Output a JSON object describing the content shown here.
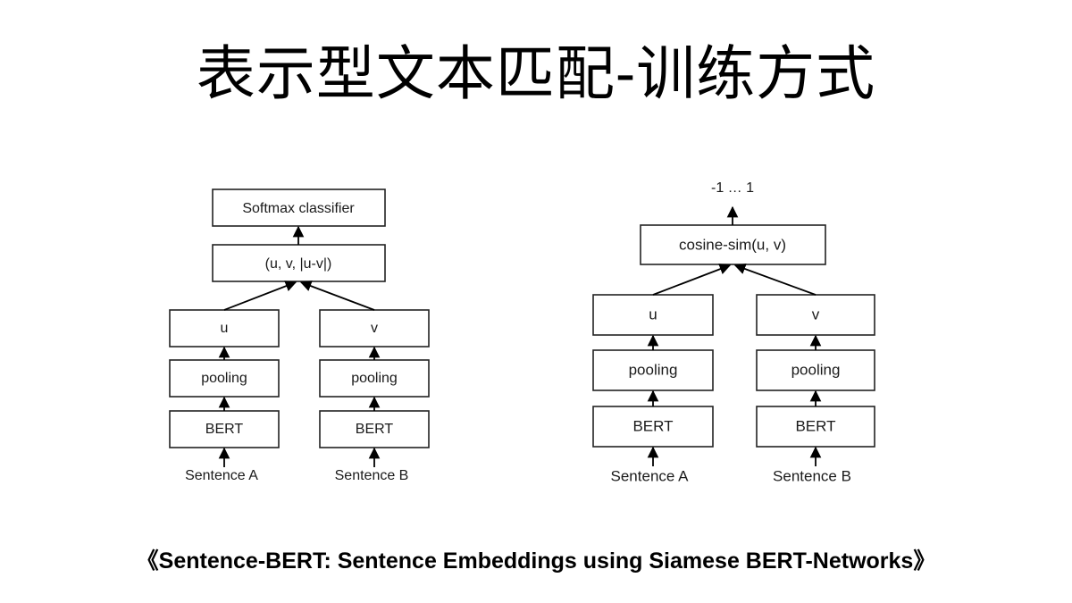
{
  "title": "表示型文本匹配-训练方式",
  "left_diagram": {
    "top_box": "Softmax classifier",
    "concat_box": "(u, v, |u-v|)",
    "left_branch": {
      "embedding": "u",
      "pooling": "pooling",
      "encoder": "BERT",
      "input": "Sentence A"
    },
    "right_branch": {
      "embedding": "v",
      "pooling": "pooling",
      "encoder": "BERT",
      "input": "Sentence B"
    }
  },
  "right_diagram": {
    "output": "-1 … 1",
    "top_box": "cosine-sim(u, v)",
    "left_branch": {
      "embedding": "u",
      "pooling": "pooling",
      "encoder": "BERT",
      "input": "Sentence A"
    },
    "right_branch": {
      "embedding": "v",
      "pooling": "pooling",
      "encoder": "BERT",
      "input": "Sentence B"
    }
  },
  "caption": "《Sentence-BERT: Sentence Embeddings using Siamese BERT-Networks》"
}
